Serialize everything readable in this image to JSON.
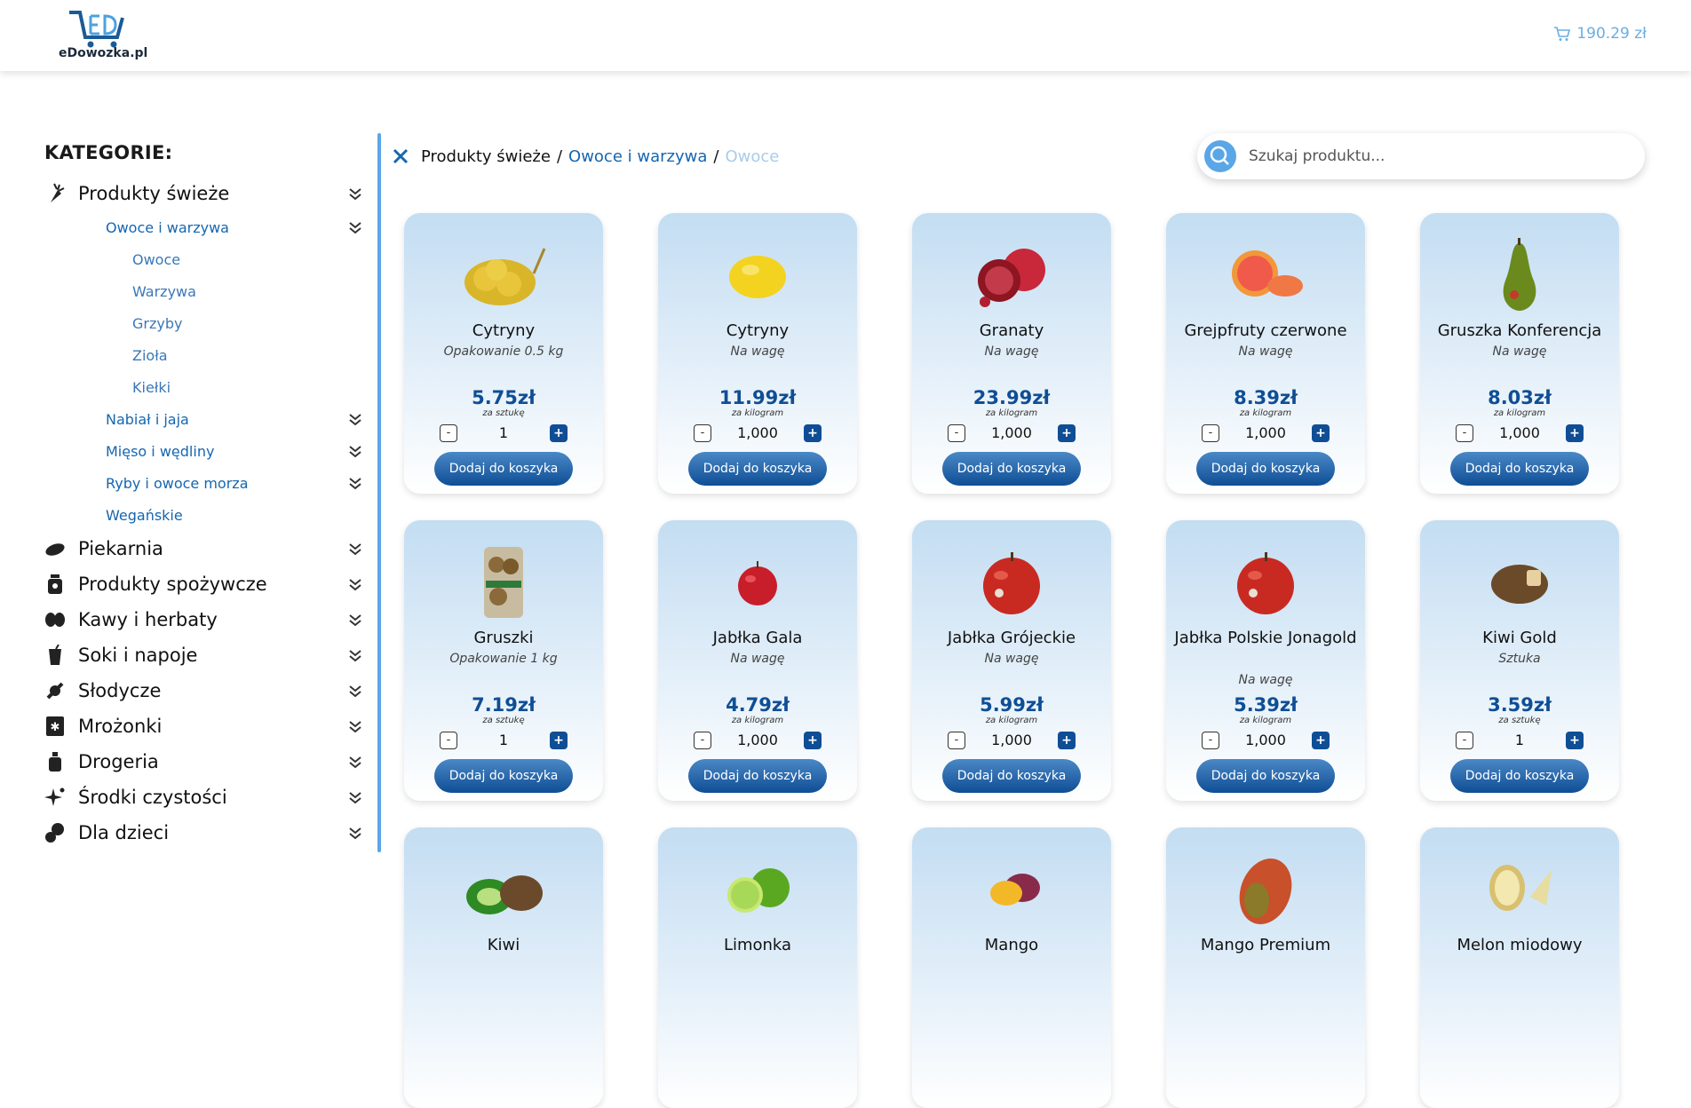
{
  "header": {
    "logo_text": "eDowozka.pl",
    "cart_total": "190.29 zł"
  },
  "sidebar": {
    "title": "KATEGORIE:",
    "categories": [
      {
        "label": "Produkty świeże",
        "icon": "carrot-icon"
      },
      {
        "label": "Piekarnia",
        "icon": "bread-icon"
      },
      {
        "label": "Produkty spożywcze",
        "icon": "jar-icon"
      },
      {
        "label": "Kawy i herbaty",
        "icon": "coffee-beans-icon"
      },
      {
        "label": "Soki i napoje",
        "icon": "drink-icon"
      },
      {
        "label": "Słodycze",
        "icon": "candy-icon"
      },
      {
        "label": "Mrożonki",
        "icon": "freezer-icon"
      },
      {
        "label": "Drogeria",
        "icon": "cosmetics-icon"
      },
      {
        "label": "Środki czystości",
        "icon": "sparkle-icon"
      },
      {
        "label": "Dla dzieci",
        "icon": "baby-icon"
      }
    ],
    "subcategories": [
      {
        "label": "Owoce i warzywa"
      },
      {
        "label": "Nabiał i jaja"
      },
      {
        "label": "Mięso i wędliny"
      },
      {
        "label": "Ryby i owoce morza"
      },
      {
        "label": "Wegańskie"
      }
    ],
    "subsubcategories": [
      {
        "label": "Owoce"
      },
      {
        "label": "Warzywa"
      },
      {
        "label": "Grzyby"
      },
      {
        "label": "Zioła"
      },
      {
        "label": "Kiełki"
      }
    ]
  },
  "breadcrumb": {
    "level1": "Produkty świeże",
    "level2": "Owoce i warzywa",
    "level3": "Owoce",
    "separator": "/"
  },
  "search": {
    "placeholder": "Szukaj produktu..."
  },
  "add_label": "Dodaj do koszyka",
  "products": [
    {
      "name": "Cytryny",
      "unit": "Opakowanie 0.5 kg",
      "price": "5.75zł",
      "per": "za sztukę",
      "qty": "1",
      "img": "lemon-bag"
    },
    {
      "name": "Cytryny",
      "unit": "Na wagę",
      "price": "11.99zł",
      "per": "za kilogram",
      "qty": "1,000",
      "img": "lemon"
    },
    {
      "name": "Granaty",
      "unit": "Na wagę",
      "price": "23.99zł",
      "per": "za kilogram",
      "qty": "1,000",
      "img": "pomegranate"
    },
    {
      "name": "Grejpfruty czerwone",
      "unit": "Na wagę",
      "price": "8.39zł",
      "per": "za kilogram",
      "qty": "1,000",
      "img": "grapefruit"
    },
    {
      "name": "Gruszka Konferencja",
      "unit": "Na wagę",
      "price": "8.03zł",
      "per": "za kilogram",
      "qty": "1,000",
      "img": "pear"
    },
    {
      "name": "Gruszki",
      "unit": "Opakowanie 1 kg",
      "price": "7.19zł",
      "per": "za sztukę",
      "qty": "1",
      "img": "pear-box"
    },
    {
      "name": "Jabłka Gala",
      "unit": "Na wagę",
      "price": "4.79zł",
      "per": "za kilogram",
      "qty": "1,000",
      "img": "apple-small"
    },
    {
      "name": "Jabłka Grójeckie",
      "unit": "Na wagę",
      "price": "5.99zł",
      "per": "za kilogram",
      "qty": "1,000",
      "img": "apple"
    },
    {
      "name": "Jabłka Polskie Jonagold",
      "unit": "Na wagę",
      "price": "5.39zł",
      "per": "za kilogram",
      "qty": "1,000",
      "img": "apple"
    },
    {
      "name": "Kiwi Gold",
      "unit": "Sztuka",
      "price": "3.59zł",
      "per": "za sztukę",
      "qty": "1",
      "img": "kiwi-gold"
    },
    {
      "name": "Kiwi",
      "unit": "",
      "price": "",
      "per": "",
      "qty": "",
      "img": "kiwi"
    },
    {
      "name": "Limonka",
      "unit": "",
      "price": "",
      "per": "",
      "qty": "",
      "img": "lime"
    },
    {
      "name": "Mango",
      "unit": "",
      "price": "",
      "per": "",
      "qty": "",
      "img": "mango-small"
    },
    {
      "name": "Mango Premium",
      "unit": "",
      "price": "",
      "per": "",
      "qty": "",
      "img": "mango"
    },
    {
      "name": "Melon miodowy",
      "unit": "",
      "price": "",
      "per": "",
      "qty": "",
      "img": "melon"
    }
  ],
  "colors": {
    "accent": "#1566b0",
    "price": "#0f4e95",
    "light_accent": "#5aa6e6",
    "card_top": "#c3ddf2"
  }
}
